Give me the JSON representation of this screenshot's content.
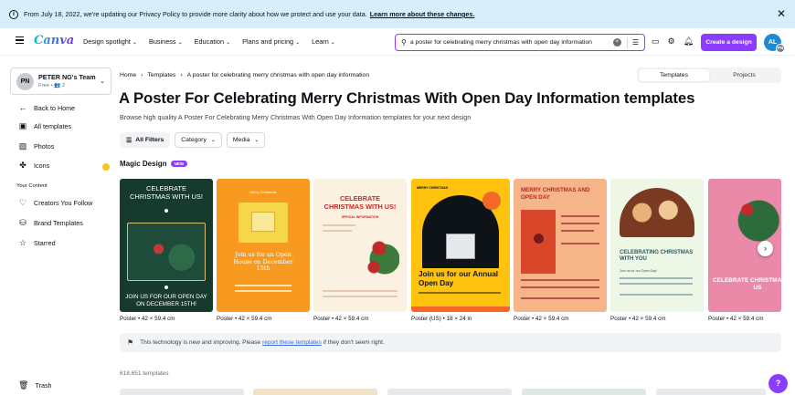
{
  "banner": {
    "text": "From July 18, 2022, we're updating our Privacy Policy to provide more clarity about how we protect and use your data.",
    "link": "Learn more about these changes."
  },
  "header": {
    "logo": "Canva",
    "nav": [
      "Design spotlight",
      "Business",
      "Education",
      "Plans and pricing",
      "Learn"
    ],
    "search_value": "a poster for celebrating merry christmas with open day information",
    "create_button": "Create a design",
    "avatar_initials": "AL",
    "avatar_badge": "PN"
  },
  "sidebar": {
    "team_initials": "PN",
    "team_name": "PETER NG's Team",
    "team_sub": "Free • 👥 2",
    "back": "Back to Home",
    "all_templates": "All templates",
    "photos": "Photos",
    "icons": "Icons",
    "your_content": "Your Content",
    "creators": "Creators You Follow",
    "brand_templates": "Brand Templates",
    "starred": "Starred",
    "trash": "Trash"
  },
  "breadcrumb": {
    "home": "Home",
    "templates": "Templates",
    "current": "A poster for celebrating merry christmas with open day information"
  },
  "toggle": {
    "templates": "Templates",
    "projects": "Projects"
  },
  "title": "A Poster For Celebrating Merry Christmas With Open Day Information templates",
  "subtitle": "Browse high quality A Poster For Celebrating Merry Christmas With Open Day Information templates for your next design",
  "filters": {
    "all": "All Filters",
    "category": "Category",
    "media": "Media"
  },
  "magic": {
    "label": "Magic Design",
    "badge": "NEW"
  },
  "cards": [
    {
      "label": "Poster • 42 × 59.4 cm",
      "top": "CELEBRATE CHRISTMAS WITH US!",
      "bottom": "JOIN US FOR OUR OPEN DAY ON DECEMBER 15TH!"
    },
    {
      "label": "Poster • 42 × 59.4 cm",
      "top": "Merry Christmas",
      "bottom": "Join us for an Open House on December 15th"
    },
    {
      "label": "Poster • 42 × 59.4 cm",
      "top": "CELEBRATE CHRISTMAS WITH US!",
      "sub": "SPECIAL INFORMATION"
    },
    {
      "label": "Poster (US) • 18 × 24 in",
      "top": "MERRY CHRISTMAS",
      "bottom": "Join us for our Annual Open Day"
    },
    {
      "label": "Poster • 42 × 59.4 cm",
      "top": "MERRY CHRISTMAS AND OPEN DAY"
    },
    {
      "label": "Poster • 42 × 59.4 cm",
      "top": "CELEBRATING CHRISTMAS WITH YOU",
      "sub": "Join us for our Open Day!"
    },
    {
      "label": "Poster • 42 × 59.4 cm",
      "top": "CELEBRATE CHRISTMAS WITH US"
    }
  ],
  "notice": {
    "before": "This technology is new and improving. Please",
    "link": "report these templates",
    "after": "if they don't seem right."
  },
  "count": "618,651 templates",
  "help": "?"
}
